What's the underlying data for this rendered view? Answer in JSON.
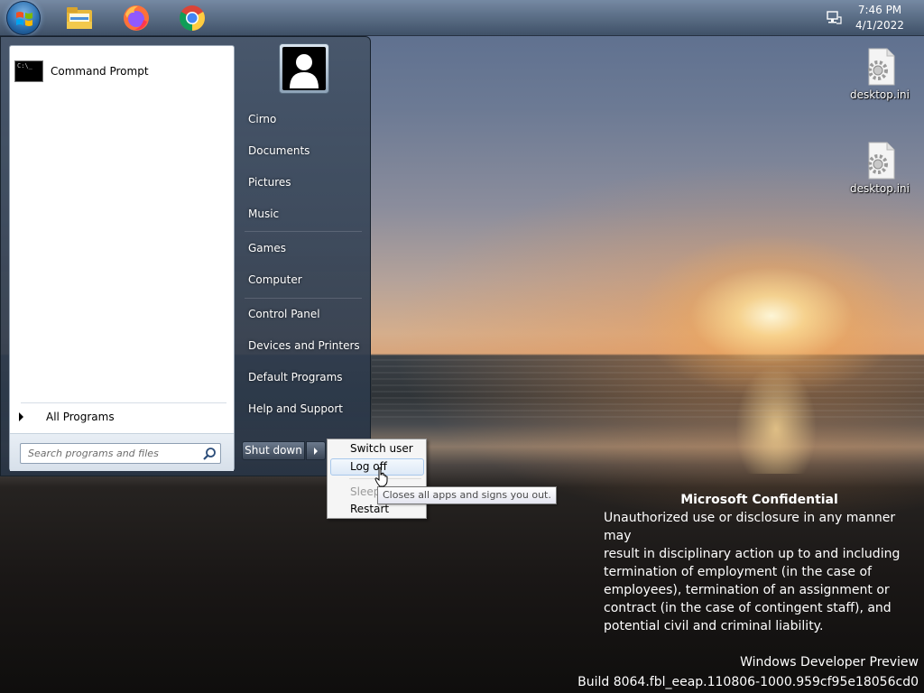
{
  "taskbar": {
    "icons": [
      "windows-start-orb",
      "file-explorer-icon",
      "firefox-icon",
      "chrome-icon"
    ],
    "tray_icon": "network-icon",
    "time": "7:46 PM",
    "date": "4/1/2022"
  },
  "desktop": {
    "icons": [
      {
        "label": "desktop.ini",
        "icon": "settings-file-icon"
      },
      {
        "label": "desktop.ini",
        "icon": "settings-file-icon"
      }
    ]
  },
  "start_menu": {
    "programs": [
      {
        "label": "Command Prompt",
        "icon": "command-prompt-icon"
      }
    ],
    "all_programs": "All Programs",
    "search_placeholder": "Search programs and files",
    "user_picture": "user-avatar-icon",
    "right_items": [
      "Cirno",
      "Documents",
      "Pictures",
      "Music",
      "Games",
      "Computer",
      "Control Panel",
      "Devices and Printers",
      "Default Programs",
      "Help and Support"
    ],
    "shutdown_label": "Shut down"
  },
  "power_menu": {
    "items": [
      "Switch user",
      "Log off",
      "Sleep",
      "Restart"
    ],
    "hovered": "Log off",
    "tooltip": "Closes all apps and signs you out."
  },
  "confidential": {
    "heading": "Microsoft Confidential",
    "lines": [
      "Unauthorized use or disclosure in any manner may",
      "result in disciplinary action up to and including",
      "termination of employment (in the case of",
      "employees), termination of an assignment or",
      "contract (in the case of contingent staff), and",
      "potential civil and criminal liability."
    ]
  },
  "watermark": {
    "line1": "Windows Developer Preview",
    "line2": "Build 8064.fbl_eeap.110806-1000.959cf95e18056cd0"
  },
  "colors": {
    "taskbar": "#4e6480",
    "start_menu_right": "#3a4a5e",
    "hover_highlight": "#dde9f7"
  }
}
